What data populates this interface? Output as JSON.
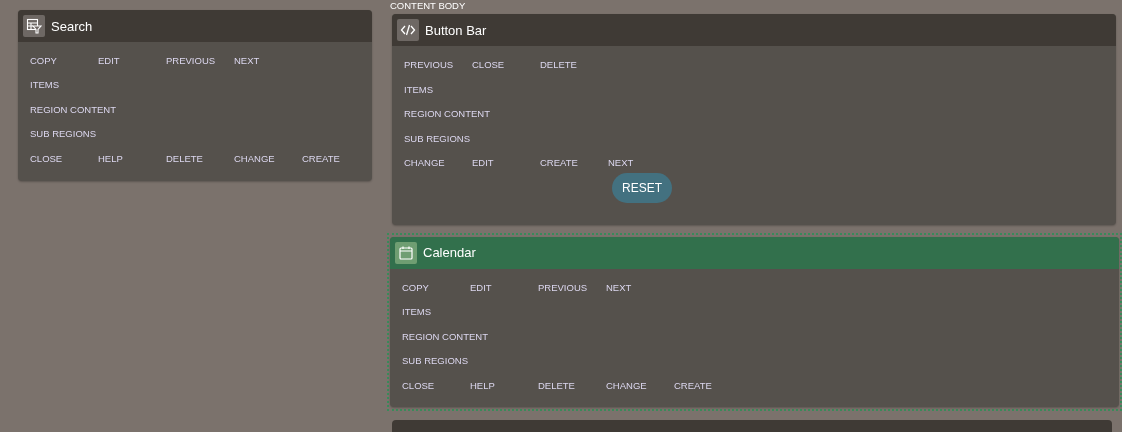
{
  "left_column": {
    "regions": [
      {
        "title": "Search",
        "kind": "search",
        "selected": false,
        "rows": [
          [
            "COPY",
            "EDIT",
            "PREVIOUS",
            "NEXT"
          ],
          [
            "ITEMS"
          ],
          [
            "REGION CONTENT"
          ],
          [
            "SUB REGIONS"
          ],
          [
            "CLOSE",
            "HELP",
            "DELETE",
            "CHANGE",
            "CREATE"
          ]
        ]
      }
    ]
  },
  "right_column": {
    "sub_label": "CONTENT BODY",
    "regions": [
      {
        "title": "Button Bar",
        "kind": "buttons",
        "selected": false,
        "rows": [
          [
            "PREVIOUS",
            "CLOSE",
            "DELETE"
          ],
          [
            "ITEMS"
          ],
          [
            "REGION CONTENT"
          ],
          [
            "SUB REGIONS"
          ],
          [
            "CHANGE",
            "EDIT",
            "CREATE",
            "NEXT"
          ]
        ],
        "button": {
          "label": "RESET"
        }
      },
      {
        "title": "Calendar",
        "kind": "calendar",
        "selected": true,
        "rows": [
          [
            "COPY",
            "EDIT",
            "PREVIOUS",
            "NEXT"
          ],
          [
            "ITEMS"
          ],
          [
            "REGION CONTENT"
          ],
          [
            "SUB REGIONS"
          ],
          [
            "CLOSE",
            "HELP",
            "DELETE",
            "CHANGE",
            "CREATE"
          ]
        ]
      }
    ]
  }
}
